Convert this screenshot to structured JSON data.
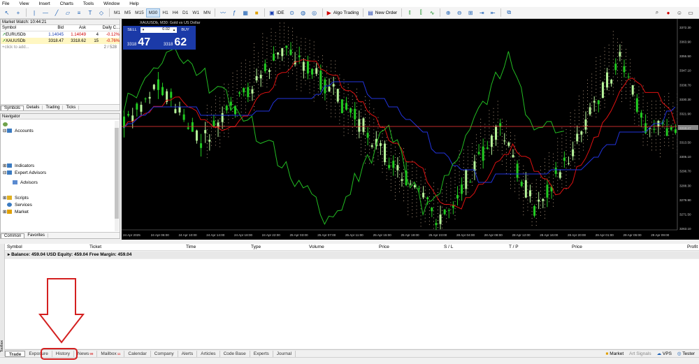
{
  "menu": [
    "File",
    "View",
    "Insert",
    "Charts",
    "Tools",
    "Window",
    "Help"
  ],
  "toolbar": {
    "timeframes": [
      "M1",
      "M5",
      "M15",
      "M30",
      "H1",
      "H4",
      "D1",
      "W1",
      "MN"
    ],
    "active_timeframe": "M30",
    "ide_label": "IDE",
    "algo_label": "Algo Trading",
    "new_order_label": "New Order"
  },
  "market_watch": {
    "title": "Market Watch: 10:44:21",
    "columns": [
      "Symbol",
      "Bid",
      "Ask",
      "Daily C..."
    ],
    "rows": [
      {
        "symbol": "EURUSDb",
        "bid": "1.14045",
        "ask": "1.14049",
        "spread": "4",
        "change": "-0.12%"
      },
      {
        "symbol": "XAUUSDb",
        "bid": "3318.47",
        "ask": "3318.62",
        "spread": "15",
        "change": "-0.76%"
      }
    ],
    "add_label": "click to add...",
    "count": "2 / 528",
    "tabs": [
      "Symbols",
      "Details",
      "Trading",
      "Ticks"
    ]
  },
  "navigator": {
    "title": "Navigator",
    "items": [
      "Accounts",
      "Indicators",
      "Expert Advisors",
      "Advisors",
      "Scripts",
      "Services",
      "Market"
    ],
    "tabs": [
      "Common",
      "Favorites"
    ]
  },
  "chart": {
    "title": "XAUUSDb, M30:  Gold vs US Dollar",
    "sell_label": "SELL",
    "buy_label": "BUY",
    "lot": "0.02",
    "sell_small": "3318",
    "sell_big": "47",
    "buy_small": "3318",
    "buy_big": "62",
    "price_labels": [
      "3372.30",
      "3363.90",
      "3355.50",
      "3347.10",
      "3338.70",
      "3330.30",
      "3321.90",
      "3318.47",
      "3313.50",
      "3305.10",
      "3296.70",
      "3288.30",
      "3279.90",
      "3271.50",
      "3263.10"
    ],
    "time_labels": [
      "24 Apr 2025",
      "24 Apr 06:00",
      "24 Apr 10:00",
      "24 Apr 14:00",
      "24 Apr 18:00",
      "24 Apr 22:00",
      "25 Apr 03:00",
      "25 Apr 07:00",
      "25 Apr 11:00",
      "25 Apr 15:00",
      "25 Apr 19:00",
      "25 Apr 23:00",
      "28 Apr 04:00",
      "28 Apr 08:00",
      "28 Apr 12:00",
      "28 Apr 16:00",
      "28 Apr 20:00",
      "29 Apr 01:00",
      "29 Apr 05:00",
      "29 Apr 09:00"
    ],
    "colors": {
      "bull": "#b6f59a",
      "bear": "#22cc22",
      "tenkan": "#dd1111",
      "kijun": "#2233dd",
      "chikou": "#22bb22",
      "cloud": "#e8c8a8",
      "price_line": "#ff3b3b"
    }
  },
  "toolbox": {
    "columns": [
      "Symbol",
      "Ticket",
      "Time",
      "Type",
      "Volume",
      "Price",
      "S / L",
      "T / P",
      "Price",
      "Profit"
    ],
    "balance_line": "Balance: 459.04 USD  Equity: 459.04  Free Margin: 459.04",
    "tabs": [
      {
        "label": "Trade",
        "badge": ""
      },
      {
        "label": "Exposure",
        "badge": ""
      },
      {
        "label": "History",
        "badge": ""
      },
      {
        "label": "News",
        "badge": "99"
      },
      {
        "label": "Mailbox",
        "badge": "11"
      },
      {
        "label": "Calendar",
        "badge": ""
      },
      {
        "label": "Company",
        "badge": ""
      },
      {
        "label": "Alerts",
        "badge": ""
      },
      {
        "label": "Articles",
        "badge": ""
      },
      {
        "label": "Code Base",
        "badge": ""
      },
      {
        "label": "Experts",
        "badge": ""
      },
      {
        "label": "Journal",
        "badge": ""
      }
    ],
    "side_label": "Toolbox",
    "right_items": [
      "Market",
      "Art Signals",
      "VPS",
      "Tester"
    ]
  },
  "annotation": {
    "color": "#d42020"
  }
}
